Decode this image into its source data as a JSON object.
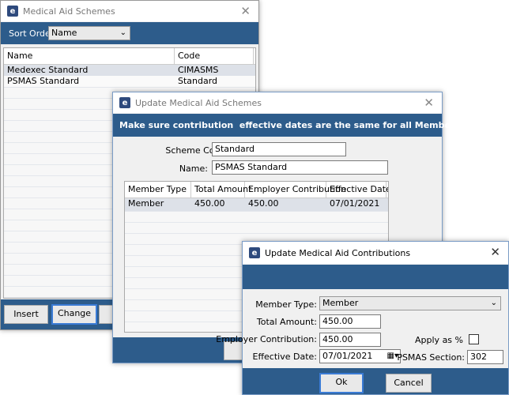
{
  "schemes_window": {
    "title": "Medical Aid Schemes",
    "sort_label": "Sort Order",
    "sort_value": "Name",
    "columns": [
      "Name",
      "Code"
    ],
    "rows": [
      {
        "name": "Medexec Standard",
        "code": "CIMASMS"
      },
      {
        "name": "PSMAS Standard",
        "code": "Standard"
      }
    ],
    "buttons": {
      "insert": "Insert",
      "change": "Change"
    }
  },
  "update_schemes": {
    "title": "Update Medical Aid Schemes",
    "banner": "Make sure contribution  effective dates are the same for all Member types",
    "scheme_code_label": "Scheme Code:",
    "scheme_code_value": "Standard",
    "name_label": "Name:",
    "name_value": "PSMAS Standard",
    "columns": [
      "Member Type",
      "Total Amount",
      "Employer Contribution",
      "Effective Date"
    ],
    "rows": [
      {
        "member_type": "Member",
        "total": "450.00",
        "employer": "450.00",
        "date": "07/01/2021"
      }
    ]
  },
  "update_contrib": {
    "title": "Update Medical Aid Contributions",
    "member_type_label": "Member Type:",
    "member_type_value": "Member",
    "total_label": "Total Amount:",
    "total_value": "450.00",
    "employer_label": "Employer Contribution:",
    "employer_value": "450.00",
    "apply_label": "Apply as %",
    "date_label": "Effective Date:",
    "date_value": "07/01/2021",
    "psmas_label": "PSMAS Section:",
    "psmas_value": "302",
    "ok_label": "Ok",
    "cancel_label": "Cancel"
  }
}
